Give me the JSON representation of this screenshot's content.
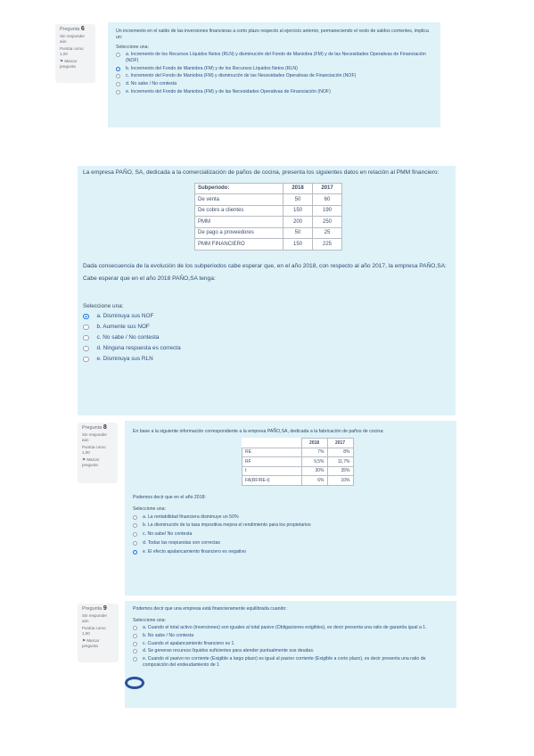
{
  "q6": {
    "info": {
      "label": "Pregunta",
      "number": "6",
      "status": "Sin responder aún",
      "score": "Puntúa como 1,00",
      "flag": "Marcar pregunta"
    },
    "text": "Un incremento en el saldo de las inversiones financieras a corto plazo respecto al ejercicio anterior, permaneciendo el resto de saldos corrientes, implica un:",
    "select_label": "Seleccione una:",
    "options": [
      "a. Incremento de los Recursos Líquidos Netos (RLN) y disminución del Fondo de Maniobra (FM) y de las Necesidades Operativas de Financiación (NOF)",
      "b. Incremento del Fondo de Maniobra (FM) y de los Recursos Líquidos Netos (RLN)",
      "c. Incremento del Fondo de Maniobra (FM) y disminución de las Necesidades Operativas de Financiación (NOF)",
      "d. No sabe / No contesta",
      "e. Incremento del Fondo de Maniobra (FM) y de las Necesidades Operativas de Financiación (NOF)"
    ]
  },
  "q7": {
    "intro": "La empresa PAÑO, SA, dedicada a la comercialización de paños de cocina, presenta los siguientes datos en relación al PMM financiero:",
    "table": {
      "headers": [
        "Subperíodo:",
        "2018",
        "2017"
      ],
      "rows": [
        [
          "De venta",
          "50",
          "60"
        ],
        [
          "De cobro a clientes",
          "150",
          "190"
        ],
        [
          "PMM",
          "200",
          "250"
        ],
        [
          "De pago a proveedores",
          "50",
          "25"
        ],
        [
          "PMM FINANCIERO",
          "150",
          "225"
        ]
      ]
    },
    "text2": "Dada consecuencia de la evolución de los subperiodos cabe esperar que, en el año 2018, con respecto al año 2017, la empresa PAÑO,SA:",
    "text3": "Cabe esperar que en el año 2018 PAÑO,SA tenga:",
    "select_label": "Seleccione una:",
    "options": [
      "a. Disminuya sus NOF",
      "b. Aumente sus NOF",
      "c. No sabe / No contesta",
      "d. Ninguna respuesta es correcta",
      "e. Disminuya sus RLN"
    ]
  },
  "q8": {
    "info": {
      "label": "Pregunta",
      "number": "8",
      "status": "Sin responder aún",
      "score": "Puntúa como 1,00",
      "flag": "Marcar pregunta"
    },
    "text": "En base a la siguiente información correspondiente a la empresa PAÑO,SA, dedicada a la fabricación de paños de cocina:",
    "table": {
      "headers": [
        "",
        "2018",
        "2017"
      ],
      "rows": [
        [
          "RE",
          "7%",
          "8%"
        ],
        [
          "RF",
          "9,5%",
          "11,7%"
        ],
        [
          "t",
          "30%",
          "35%"
        ],
        [
          "FA(RF/RE-t)",
          "6%",
          "10%"
        ]
      ]
    },
    "text2": "Podemos decir que en el año 2018:",
    "select_label": "Seleccione una:",
    "options": [
      "a. La rentabilidad financiera disminuye un 50%",
      "b. La disminución de la tasa impositiva mejora el rendimiento para los propietarios",
      "c. No sabe/ No contesta",
      "d. Todas las respuestas son correctas",
      "e. El efecto apalancamiento financiero es negativo"
    ]
  },
  "q9": {
    "info": {
      "label": "Pregunta",
      "number": "9",
      "status": "Sin responder aún",
      "score": "Puntúa como 1,00",
      "flag": "Marcar pregunta"
    },
    "text": "Podemos decir que una empresa está financieramente equilibrada cuando:",
    "select_label": "Seleccione una:",
    "options": [
      "a. Cuando el total activo (inversiones) son iguales al total pasivo (Obligaciones exigibles), es decir presenta una ratio de garantía igual a 1.",
      "b. No sabe / No contesta",
      "c. Cuando el apalancamiento financiero es 1",
      "d. Se generan recursos líquidos suficientes para atender puntualmente sus deudas.",
      "e. Cuando el pasivo no corriente (Exigible a largo plazo) es igual al pasivo corriente (Exigible a corto plazo), es decir presenta una ratio de composición del endeudamiento de 1"
    ]
  }
}
